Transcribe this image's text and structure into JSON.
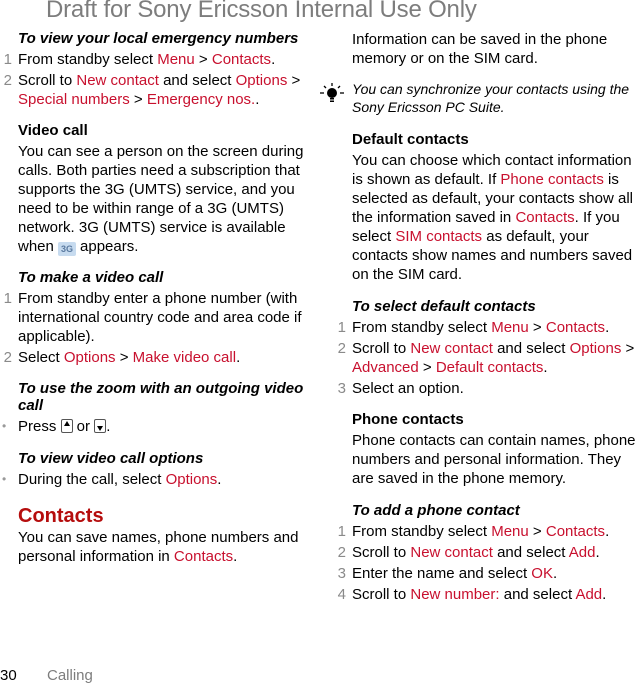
{
  "watermark": "Draft for Sony Ericsson Internal Use Only",
  "left": {
    "emergency": {
      "heading": "To view your local emergency numbers",
      "steps": [
        {
          "num": "1",
          "pre": "From standby select ",
          "l1": "Menu",
          "sep": " > ",
          "l2": "Contacts",
          "post": "."
        },
        {
          "num": "2",
          "pre": "Scroll to ",
          "l1": "New contact",
          "mid": " and select ",
          "l2": "Options",
          "sep1": " > ",
          "l3": "Special numbers",
          "sep2": " > ",
          "l4": "Emergency nos.",
          "post": "."
        }
      ]
    },
    "video_call": {
      "heading": "Video call",
      "body": "You can see a person on the screen during calls. Both parties need a subscription that supports the 3G (UMTS) service, and you need to be within range of a 3G (UMTS) network. 3G (UMTS) service is available when",
      "icon_label": "3G",
      "body_end": "appears."
    },
    "make_video_call": {
      "heading": "To make a video call",
      "steps": [
        {
          "num": "1",
          "text": "From standby enter a phone number (with international country code and area code if applicable)."
        },
        {
          "num": "2",
          "pre": "Select ",
          "l1": "Options",
          "sep": " > ",
          "l2": "Make video call",
          "post": "."
        }
      ]
    },
    "zoom": {
      "heading": "To use the zoom with an outgoing video call",
      "bullet": "•",
      "pre": "Press ",
      "mid": " or ",
      "post": "."
    },
    "options": {
      "heading": "To view video call options",
      "bullet": "•",
      "pre": "During the call, select ",
      "l1": "Options",
      "post": "."
    },
    "contacts": {
      "heading": "Contacts",
      "pre": "You can save names, phone numbers and personal information in ",
      "l1": "Contacts",
      "post": "."
    }
  },
  "right": {
    "intro": "Information can be saved in the phone memory or on the SIM card.",
    "tip": "You can synchronize your contacts using the Sony Ericsson PC Suite.",
    "default_contacts": {
      "heading": "Default contacts",
      "p1": "You can choose which contact information is shown as default. If ",
      "l1": "Phone contacts",
      "p2": " is selected as default, your contacts show all the information saved in ",
      "l2": "Contacts",
      "p3": ". If you select ",
      "l3": "SIM contacts",
      "p4": " as default, your contacts show names and numbers saved on the SIM card."
    },
    "select_default": {
      "heading": "To select default contacts",
      "steps": [
        {
          "num": "1",
          "pre": "From standby select ",
          "l1": "Menu",
          "sep": " > ",
          "l2": "Contacts",
          "post": "."
        },
        {
          "num": "2",
          "pre": "Scroll to ",
          "l1": "New contact",
          "mid": " and select ",
          "l2": "Options",
          "sep1": " > ",
          "l3": "Advanced",
          "sep2": " > ",
          "l4": "Default contacts",
          "post": "."
        },
        {
          "num": "3",
          "text": "Select an option."
        }
      ]
    },
    "phone_contacts": {
      "heading": "Phone contacts",
      "body": "Phone contacts can contain names, phone numbers and personal information. They are saved in the phone memory."
    },
    "add_contact": {
      "heading": "To add a phone contact",
      "steps": [
        {
          "num": "1",
          "pre": "From standby select ",
          "l1": "Menu",
          "sep": " > ",
          "l2": "Contacts",
          "post": "."
        },
        {
          "num": "2",
          "pre": "Scroll to ",
          "l1": "New contact",
          "mid": " and select ",
          "l2": "Add",
          "post": "."
        },
        {
          "num": "3",
          "pre": "Enter the name and select ",
          "l1": "OK",
          "post": "."
        },
        {
          "num": "4",
          "pre": "Scroll to ",
          "l1": "New number:",
          "mid": " and select ",
          "l2": "Add",
          "post": "."
        }
      ]
    }
  },
  "footer": {
    "page_number": "30",
    "chapter": "Calling"
  }
}
